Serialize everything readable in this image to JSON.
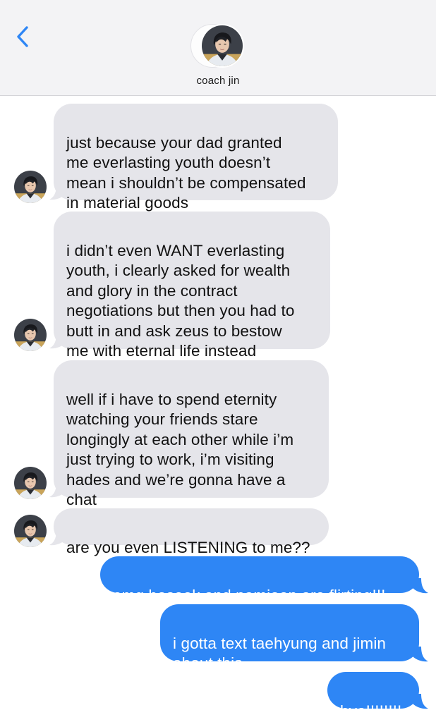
{
  "header": {
    "back_icon": "chevron-left-icon",
    "contact_name": "coach jin"
  },
  "colors": {
    "incoming_bubble": "#e5e5ea",
    "outgoing_bubble": "#2e86f5",
    "accent": "#2e86f5",
    "header_bg": "#f3f3f5"
  },
  "messages": [
    {
      "direction": "incoming",
      "text": "just because your dad granted\nme everlasting youth doesn’t\nmean i shouldn’t be compensated\nin material goods"
    },
    {
      "direction": "incoming",
      "text": "i didn’t even WANT everlasting\nyouth, i clearly asked for wealth\nand glory in the contract\nnegotiations but then you had to\nbutt in and ask zeus to bestow\nme with eternal life instead"
    },
    {
      "direction": "incoming",
      "text": "well if i have to spend eternity\nwatching your friends stare\nlongingly at each other while i’m\njust trying to work, i’m visiting\nhades and we’re gonna have a\nchat"
    },
    {
      "direction": "incoming",
      "text": "are you even LISTENING to me??"
    },
    {
      "direction": "outgoing",
      "text": "omg hoseok and namjoon are flirting!!!"
    },
    {
      "direction": "outgoing",
      "text": "i gotta text taehyung and jimin\nabout this"
    },
    {
      "direction": "outgoing",
      "text": "bye!!!!!!!!"
    }
  ]
}
